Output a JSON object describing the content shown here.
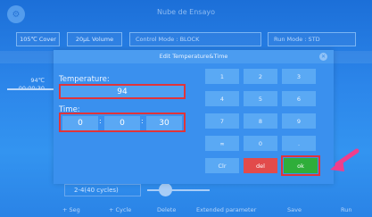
{
  "top": {
    "title": "Nube de Ensayo"
  },
  "toolbar": {
    "cover": "105℃ Cover",
    "volume": "20μL Volume",
    "control_mode": "Control Mode : BLOCK",
    "run_mode": "Run Mode : STD"
  },
  "stage": {
    "temp": "94℃",
    "time": "00:00:30",
    "cycles": "2-4(40 cycles)"
  },
  "bottom_bar": {
    "seg": "+ Seg",
    "cycle": "+ Cycle",
    "delete": "Delete",
    "extended": "Extended parameter",
    "save": "Save",
    "run": "Run"
  },
  "dialog": {
    "title": "Edit Temperature&Time",
    "temperature_label": "Temperature:",
    "temperature_value": "94",
    "time_label": "Time:",
    "time_hours": "0",
    "time_minutes": "0",
    "time_seconds": "30",
    "colon": ":"
  },
  "keypad": {
    "k1": "1",
    "k2": "2",
    "k3": "3",
    "k4": "4",
    "k5": "5",
    "k6": "6",
    "k7": "7",
    "k8": "8",
    "k9": "9",
    "kinf": "∞",
    "k0": "0",
    "kdot": ".",
    "clr": "Clr",
    "del": "del",
    "ok": "ok"
  },
  "colors": {
    "background": "#2c86ea",
    "dialog": "#3a90ee",
    "highlight": "#e0343a",
    "ok": "#2fae3a",
    "del": "#e24b4b",
    "arrow": "#ef3e8c"
  },
  "icons": {
    "settings": "gear-icon",
    "close": "close-icon",
    "pointer": "arrow-icon"
  }
}
